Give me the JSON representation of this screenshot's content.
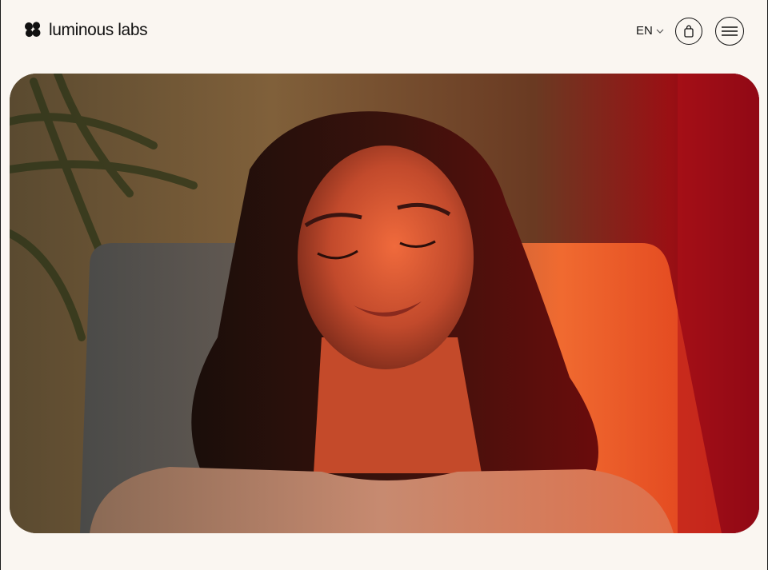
{
  "brand": {
    "name": "luminous labs",
    "logo_icon": "four-dots-logo-icon"
  },
  "header": {
    "language": "EN",
    "language_chevron_icon": "chevron-down-icon",
    "cart_icon": "shopping-bag-icon",
    "menu_icon": "hamburger-menu-icon"
  },
  "hero": {
    "image_alt": "",
    "colors": {
      "background": "#faf6f1",
      "accent_red": "#c4100f",
      "warm_orange": "#ef5a1a"
    }
  }
}
